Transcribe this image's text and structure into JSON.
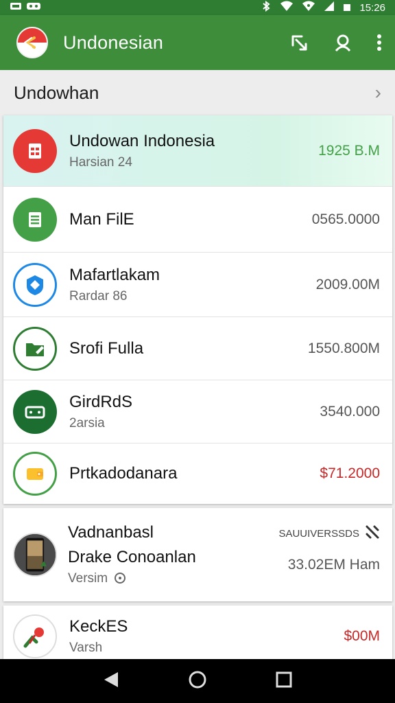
{
  "status_bar": {
    "time": "15:26",
    "left_icons": [
      "notification-icon",
      "notification-icon"
    ],
    "right_icons": [
      "bluetooth-icon",
      "wifi-icon",
      "signal-icon",
      "battery-icon"
    ]
  },
  "app_bar": {
    "title": "Undonesian",
    "actions": [
      "shortcut-icon",
      "search-icon",
      "more-vert-icon"
    ]
  },
  "section": {
    "title": "Undowhan"
  },
  "list_top": [
    {
      "title": "Undowan Indonesia",
      "subtitle": "Harsian 24",
      "value": "1925 B.M",
      "icon": "document-icon",
      "color": "#e53935",
      "value_color": "green",
      "highlight": true
    },
    {
      "title": "Man FilE",
      "subtitle": "",
      "value": "0565.0000",
      "icon": "list-icon",
      "color": "#43a047",
      "value_color": "",
      "highlight": false
    },
    {
      "title": "Mafartlakam",
      "subtitle": "Rardar 86",
      "value": "2009.00M",
      "icon": "shield-icon",
      "color": "#1e88e5",
      "value_color": "",
      "highlight": false
    },
    {
      "title": "Srofi Fulla",
      "subtitle": "",
      "value": "1550.800M",
      "icon": "folder-edit-icon",
      "color": "#2e7d32",
      "value_color": "",
      "highlight": false
    },
    {
      "title": "GirdRdS",
      "subtitle": "2arsia",
      "value": "3540.000",
      "icon": "card-icon",
      "color": "#1b6e30",
      "value_color": "",
      "highlight": false
    },
    {
      "title": "Prtkadodanara",
      "subtitle": "",
      "value": "$71.2000",
      "icon": "wallet-icon",
      "color": "#fbc02d",
      "value_color": "red",
      "highlight": false
    }
  ],
  "list_bottom": [
    {
      "title": "Vadnanbasl",
      "title2": "Drake Conoanlan",
      "subtitle": "Versim",
      "meta": "SAUUIVERSSDS",
      "value": "33.02EM Ham",
      "icon": "photo-icon"
    },
    {
      "title": "KeckES",
      "subtitle": "Varsh",
      "value": "$00M",
      "icon": "pin-icon"
    }
  ],
  "nav_bar": {
    "buttons": [
      "back-icon",
      "home-icon",
      "recents-icon"
    ]
  }
}
